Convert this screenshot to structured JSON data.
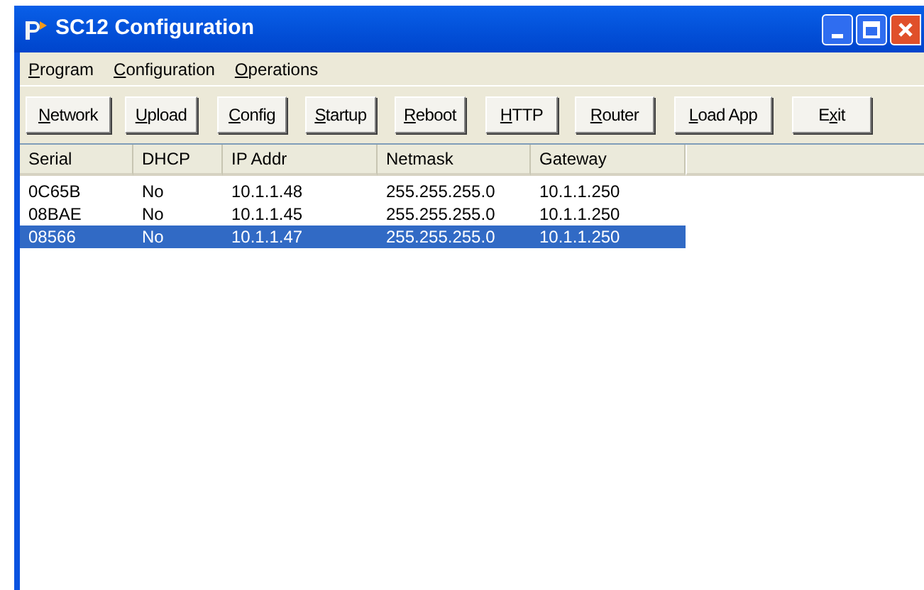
{
  "window": {
    "title": "SC12 Configuration"
  },
  "menu": [
    {
      "key": "P",
      "rest": "rogram"
    },
    {
      "key": "C",
      "rest": "onfiguration"
    },
    {
      "key": "O",
      "rest": "perations"
    }
  ],
  "buttons": [
    {
      "key": "N",
      "after": "etwork"
    },
    {
      "key": "U",
      "after": "pload"
    },
    {
      "key": "C",
      "after": "onfig"
    },
    {
      "key": "S",
      "after": "tartup"
    },
    {
      "key": "R",
      "after": "eboot"
    },
    {
      "key": "H",
      "after": "TTP"
    },
    {
      "key": "R",
      "after": "outer"
    },
    {
      "key": "L",
      "after": "oad App"
    },
    {
      "before": "E",
      "key": "x",
      "after": "it"
    }
  ],
  "table": {
    "columns": [
      "Serial",
      "DHCP",
      "IP Addr",
      "Netmask",
      "Gateway"
    ],
    "rows": [
      {
        "cells": [
          "0C65B",
          "No",
          "10.1.1.48",
          "255.255.255.0",
          "10.1.1.250"
        ],
        "selected": false
      },
      {
        "cells": [
          "08BAE",
          "No",
          "10.1.1.45",
          "255.255.255.0",
          "10.1.1.250"
        ],
        "selected": false
      },
      {
        "cells": [
          "08566",
          "No",
          "10.1.1.47",
          "255.255.255.0",
          "10.1.1.250"
        ],
        "selected": true
      }
    ]
  }
}
